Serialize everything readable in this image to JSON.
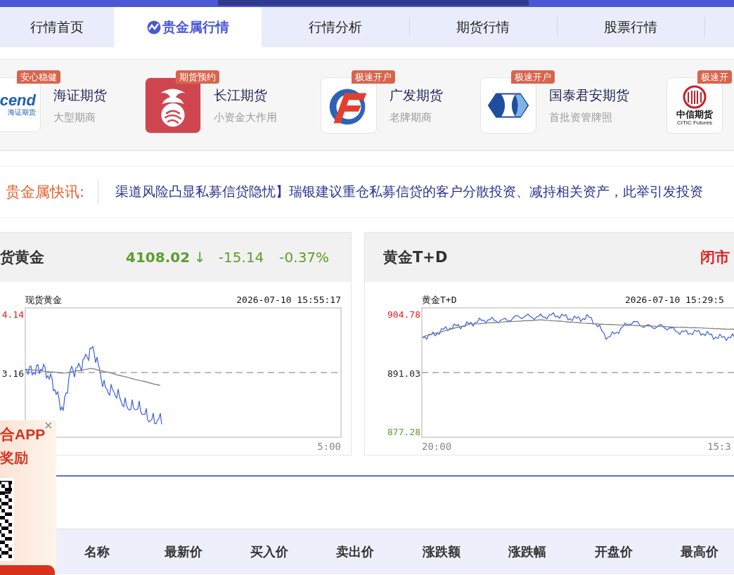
{
  "nav": {
    "tabs": [
      {
        "label": "行情首页",
        "selected": false
      },
      {
        "label": "贵金属行情",
        "selected": true
      },
      {
        "label": "行情分析",
        "selected": false
      },
      {
        "label": "期货行情",
        "selected": false
      },
      {
        "label": "股票行情",
        "selected": false
      }
    ]
  },
  "brokers": [
    {
      "kind": "haizheng",
      "logo_texts": [
        "cend",
        "海证期货"
      ],
      "name": "海证期货",
      "tagline": "大型期商",
      "badge": "安心稳健"
    },
    {
      "kind": "changjiang",
      "name": "长江期货",
      "tagline": "小资金大作用",
      "badge": "期货预约"
    },
    {
      "kind": "guangfa",
      "name": "广发期货",
      "tagline": "老牌期商",
      "badge": "极速开户"
    },
    {
      "kind": "guotai",
      "name": "国泰君安期货",
      "tagline": "首批资管牌照",
      "badge": "极速开户"
    },
    {
      "kind": "citic",
      "logo_texts": [
        "中信期货",
        "CITIC Futures"
      ],
      "badge": "极速开"
    }
  ],
  "news": {
    "label": "贵金属快讯:",
    "text": "渠道风险凸显私募信贷隐忧】瑞银建议重仓私募信贷的客户分散投资、减持相关资产，此举引发投资"
  },
  "quotes": [
    {
      "kind": "price",
      "title": "货黄金",
      "falling": true,
      "price": "4108.02",
      "arrow": "↓",
      "change": "-15.14",
      "percent": "-0.37%",
      "chart": {
        "name": "现货黄金",
        "time": "2026-07-10 15:55:17",
        "y_labels": [
          {
            "text": "4.14",
            "color": "#dd2222"
          },
          {
            "text": "3.16",
            "color": "#222222"
          }
        ],
        "x_labels": [
          "5:00"
        ]
      }
    },
    {
      "kind": "closed",
      "title": "黄金T+D",
      "status": "闭市",
      "chart": {
        "name": "黄金T+D",
        "time": "2026-07-10 15:29:5",
        "y_labels": [
          {
            "text": "904.78",
            "color": "#dd2222"
          },
          {
            "text": "891.03",
            "color": "#222222"
          },
          {
            "text": "877.28",
            "color": "#5aa02c"
          }
        ],
        "x_labels": [
          "20:00",
          "15:3"
        ]
      }
    }
  ],
  "ad": {
    "lines": [
      "合APP",
      "奖励"
    ],
    "close": "×"
  },
  "table": {
    "columns": [
      "名称",
      "最新价",
      "买入价",
      "卖出价",
      "涨跌额",
      "涨跌幅",
      "开盘价",
      "最高价"
    ]
  }
}
